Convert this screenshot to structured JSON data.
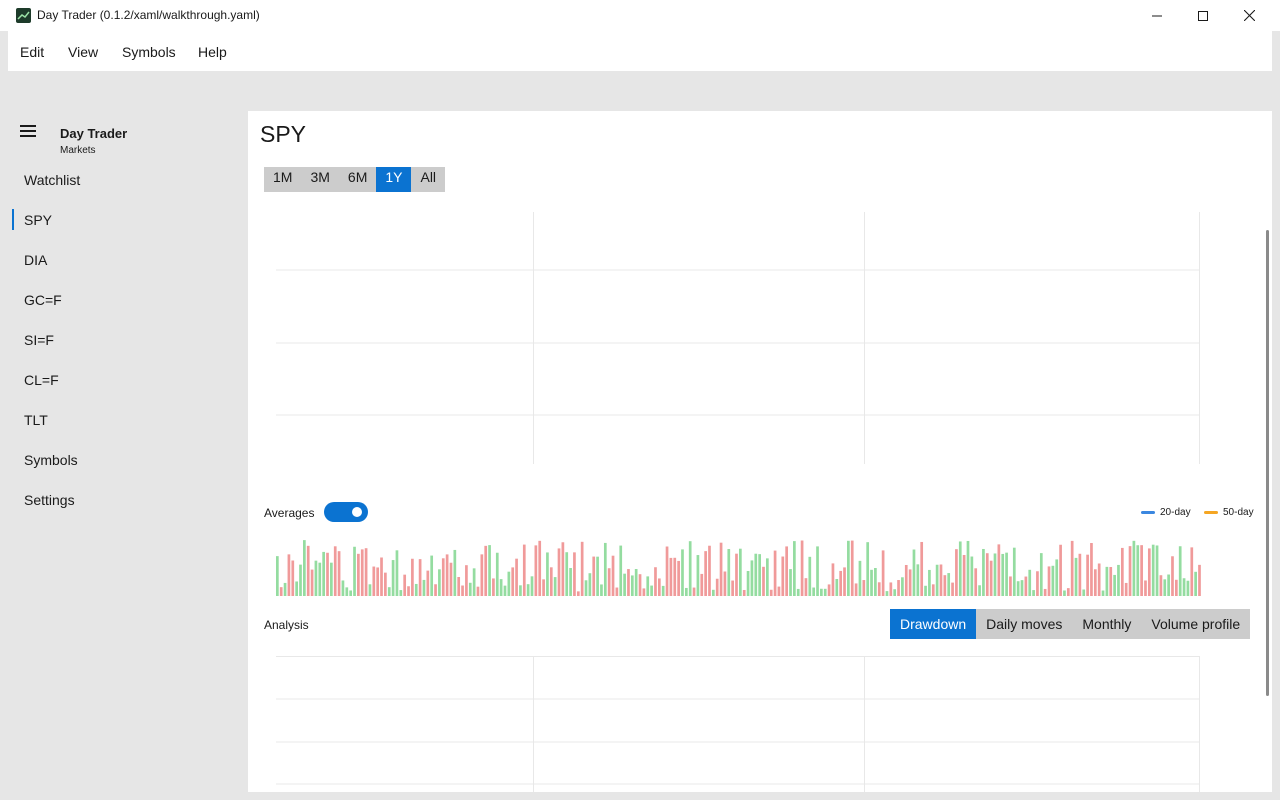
{
  "window": {
    "title": "Day Trader (0.1.2/xaml/walkthrough.yaml)"
  },
  "menu": {
    "items": [
      "Edit",
      "View",
      "Symbols",
      "Help"
    ]
  },
  "sidebar": {
    "app_name": "Day Trader",
    "app_subtitle": "Markets",
    "selected": "SPY",
    "items": [
      "Watchlist",
      "SPY",
      "DIA",
      "GC=F",
      "SI=F",
      "CL=F",
      "TLT",
      "Symbols",
      "Settings"
    ]
  },
  "main": {
    "title": "SPY",
    "ranges": [
      "1M",
      "3M",
      "6M",
      "1Y",
      "All"
    ],
    "selected_range": "1Y",
    "averages_label": "Averages",
    "averages_on": true,
    "legend": [
      {
        "label": "20-day",
        "color": "#3b87e0"
      },
      {
        "label": "50-day",
        "color": "#f5a623"
      }
    ],
    "analysis_label": "Analysis",
    "analysis_tabs": [
      "Drawdown",
      "Daily moves",
      "Monthly",
      "Volume profile"
    ],
    "selected_analysis": "Drawdown"
  },
  "colors": {
    "accent": "#0b73d1",
    "volume_up": "#94dca0",
    "volume_down": "#f09a9a"
  },
  "chart_data": {
    "type": "bar",
    "volume_bar_count": 240,
    "volume_seed": 12
  }
}
